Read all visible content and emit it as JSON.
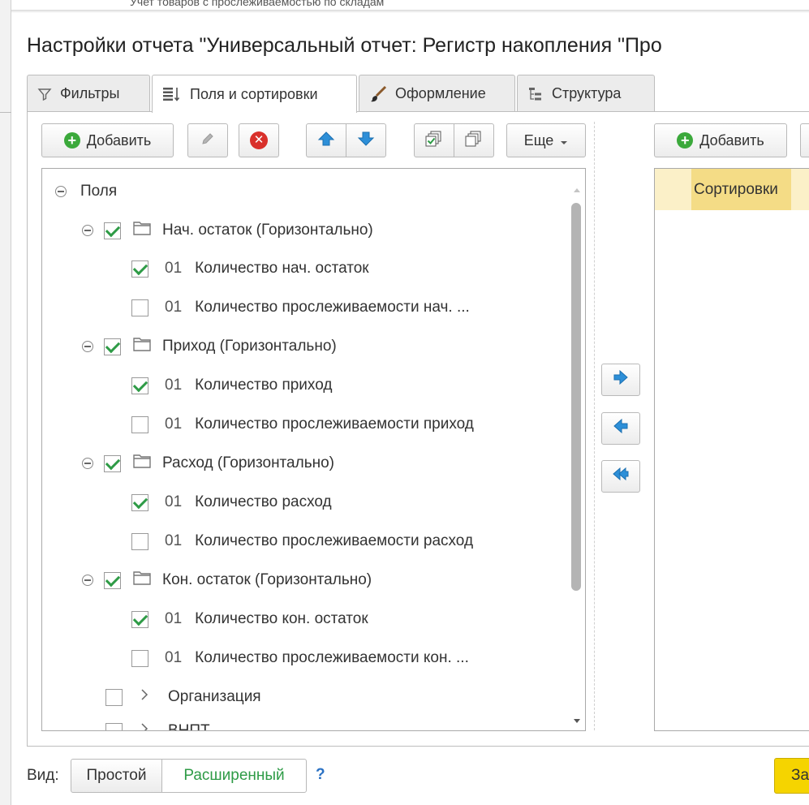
{
  "background_window": {
    "title_partial": "Учет товаров с прослеживаемостью по складам"
  },
  "dialog": {
    "title": "Настройки отчета \"Универсальный отчет: Регистр накопления \"Про"
  },
  "tabs": [
    {
      "label": "Фильтры",
      "icon": "funnel-icon"
    },
    {
      "label": "Поля и сортировки",
      "icon": "fields-sort-icon",
      "active": true
    },
    {
      "label": "Оформление",
      "icon": "brush-icon"
    },
    {
      "label": "Структура",
      "icon": "structure-icon"
    }
  ],
  "fields_toolbar": {
    "add_label": "Добавить",
    "more_label": "Еще",
    "icons": [
      "plus-icon",
      "pencil-icon",
      "delete-icon",
      "move-up-icon",
      "move-down-icon",
      "check-all-icon",
      "uncheck-all-icon",
      "dropdown-arrow-icon"
    ]
  },
  "tree": {
    "root_label": "Поля",
    "groups": [
      {
        "label": "Нач. остаток (Горизонтально)",
        "checked": true,
        "items": [
          {
            "code": "01",
            "label": "Количество нач. остаток",
            "checked": true
          },
          {
            "code": "01",
            "label": "Количество прослеживаемости нач. ...",
            "checked": false
          }
        ]
      },
      {
        "label": "Приход (Горизонтально)",
        "checked": true,
        "items": [
          {
            "code": "01",
            "label": "Количество приход",
            "checked": true
          },
          {
            "code": "01",
            "label": "Количество прослеживаемости приход",
            "checked": false
          }
        ]
      },
      {
        "label": "Расход (Горизонтально)",
        "checked": true,
        "items": [
          {
            "code": "01",
            "label": "Количество расход",
            "checked": true
          },
          {
            "code": "01",
            "label": "Количество прослеживаемости расход",
            "checked": false
          }
        ]
      },
      {
        "label": "Кон. остаток (Горизонтально)",
        "checked": true,
        "items": [
          {
            "code": "01",
            "label": "Количество кон. остаток",
            "checked": true
          },
          {
            "code": "01",
            "label": "Количество прослеживаемости кон. ...",
            "checked": false
          }
        ]
      }
    ],
    "extra_items": [
      {
        "label": "Организация",
        "checked": false
      },
      {
        "label": "ВНПТ",
        "checked": false
      }
    ]
  },
  "transfer_buttons": [
    "arrow-right-icon",
    "arrow-left-icon",
    "double-arrow-left-icon"
  ],
  "sort_panel": {
    "add_label": "Добавить",
    "header_label": "Сортировки"
  },
  "bottom": {
    "view_label": "Вид:",
    "simple_label": "Простой",
    "extended_label": "Расширенный",
    "help_label": "?",
    "close_label": "Закрыть"
  },
  "colors": {
    "check_green": "#2e9b46",
    "add_green": "#3ba93b",
    "delete_red": "#d9302b",
    "arrow_blue": "#2d8fd8",
    "sort_header_bg": "#f4dc86",
    "primary_yellow": "#f5d400",
    "extended_text": "#2e9b46"
  }
}
